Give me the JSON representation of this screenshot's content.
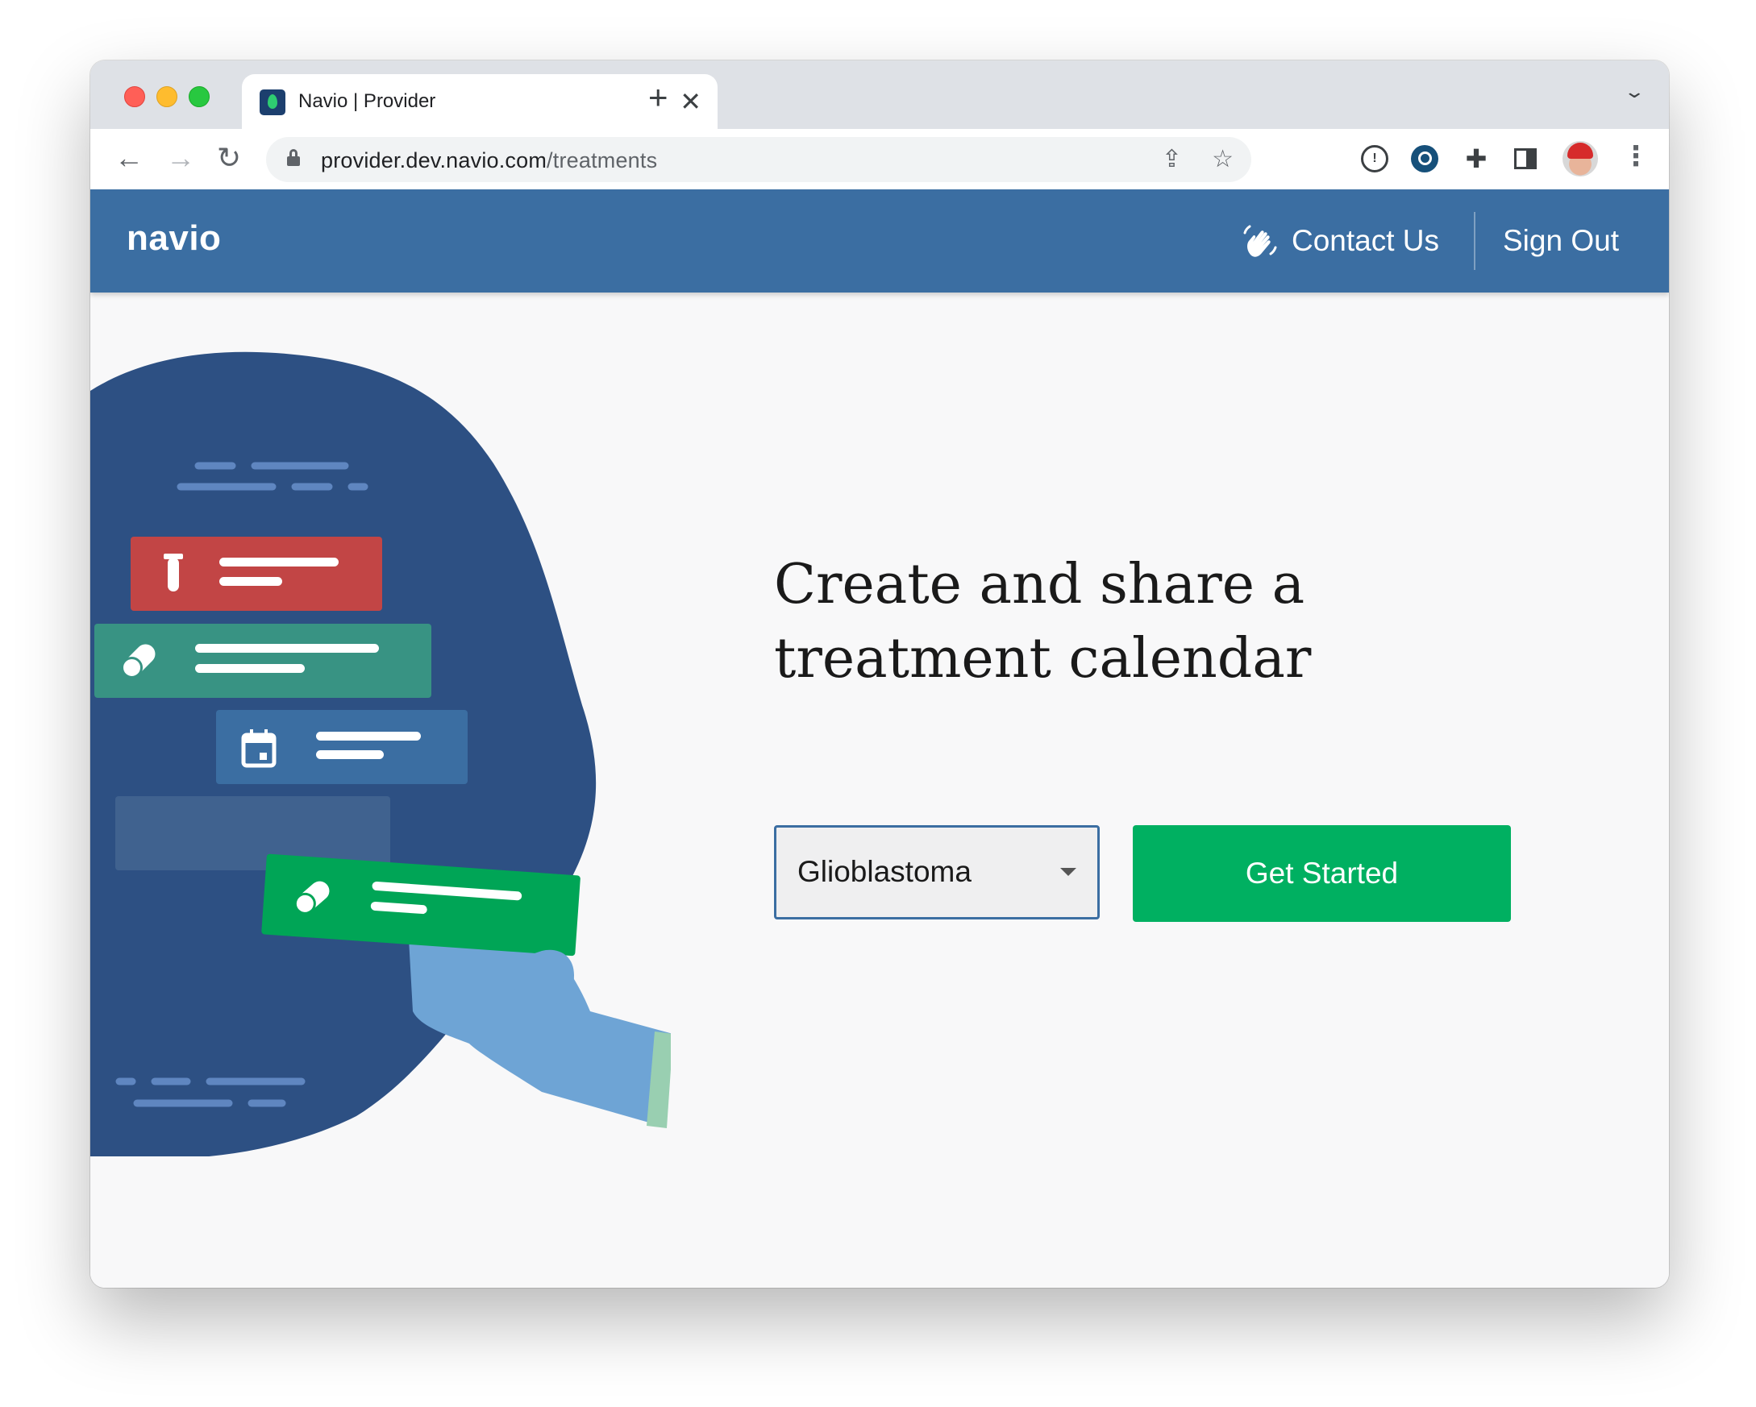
{
  "browser": {
    "tab_title": "Navio | Provider",
    "tab_close": "✕",
    "new_tab": "+",
    "url_host": "provider.dev.navio.com",
    "url_path": "/treatments"
  },
  "header": {
    "brand": "navio",
    "contact_label": "Contact Us",
    "signout_label": "Sign Out"
  },
  "hero": {
    "title": "Create and share a treatment calendar",
    "condition_select_value": "Glioblastoma",
    "cta_label": "Get Started"
  },
  "colors": {
    "header_bg": "#3b6ea2",
    "cta_bg": "#00b061",
    "page_bg": "#f8f8f9",
    "blob": "#2d5083",
    "card_red": "#c24545",
    "card_teal": "#389383",
    "card_blue": "#3b6ea2",
    "card_green": "#00a556"
  },
  "icons": [
    "wave-hand-icon",
    "lock-icon",
    "share-icon",
    "star-icon",
    "test-tube-icon",
    "pill-icon",
    "calendar-icon",
    "chevron-down-icon"
  ]
}
